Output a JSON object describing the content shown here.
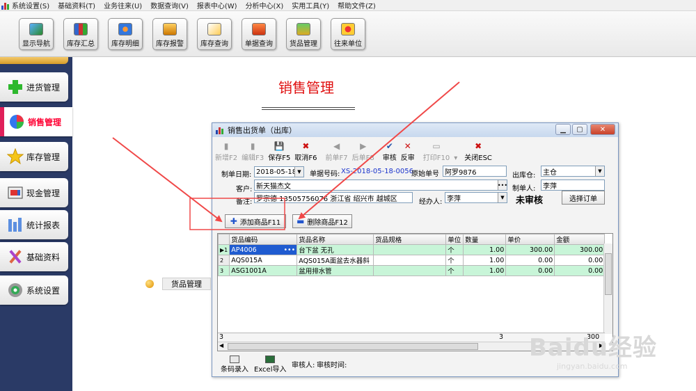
{
  "colors": {
    "accent": "#e01010",
    "sidebar_bg": "#2a3a66",
    "selection": "#1f5bd0",
    "row_green": "#c8f5d8",
    "arrow": "#f04848"
  },
  "menubar": {
    "items": [
      "系统设置(S)",
      "基础资料(T)",
      "业务往来(U)",
      "数据查询(V)",
      "报表中心(W)",
      "分析中心(X)",
      "实用工具(Y)",
      "帮助文件(Z)"
    ]
  },
  "toolbar": {
    "buttons": [
      {
        "label": "显示导航",
        "icon": "navigation-icon"
      },
      {
        "label": "库存汇总",
        "icon": "inventory-summary-icon"
      },
      {
        "label": "库存明细",
        "icon": "inventory-detail-icon"
      },
      {
        "label": "库存报警",
        "icon": "inventory-alarm-icon"
      },
      {
        "label": "库存查询",
        "icon": "inventory-query-icon"
      },
      {
        "label": "单据查询",
        "icon": "document-query-icon"
      },
      {
        "label": "货品管理",
        "icon": "goods-icon"
      },
      {
        "label": "往来单位",
        "icon": "partner-icon"
      }
    ]
  },
  "sidebar": {
    "items": [
      {
        "label": "进货管理",
        "icon": "plus-icon"
      },
      {
        "label": "销售管理",
        "icon": "globe-icon",
        "active": true
      },
      {
        "label": "库存管理",
        "icon": "star-icon"
      },
      {
        "label": "现金管理",
        "icon": "cash-icon"
      },
      {
        "label": "统计报表",
        "icon": "bar-chart-icon"
      },
      {
        "label": "基础资料",
        "icon": "tools-icon"
      },
      {
        "label": "系统设置",
        "icon": "gear-icon"
      }
    ]
  },
  "main": {
    "title": "销售管理",
    "goods_link": "货品管理"
  },
  "dialog": {
    "title": "销售出货单（出库）",
    "toolbar": [
      {
        "label": "新增F2",
        "icon": "▮",
        "disabled": true
      },
      {
        "label": "编辑F3",
        "icon": "▮",
        "disabled": true
      },
      {
        "label": "保存F5",
        "icon": "💾",
        "disabled": false
      },
      {
        "label": "取消F6",
        "icon": "✖",
        "disabled": false
      },
      {
        "label": "前单F7",
        "icon": "◀",
        "disabled": true
      },
      {
        "label": "后单F8",
        "icon": "▶",
        "disabled": true
      },
      {
        "label": "审核",
        "icon": "✔",
        "disabled": false
      },
      {
        "label": "反审",
        "icon": "✕",
        "disabled": false
      },
      {
        "label": "打印F10",
        "icon": "▭",
        "disabled": true
      },
      {
        "label": "▾",
        "icon": "",
        "disabled": true
      },
      {
        "label": "关闭ESC",
        "icon": "✖",
        "disabled": false
      }
    ],
    "form": {
      "date_label": "制单日期:",
      "date_value": "2018-05-18",
      "doc_no_label": "单据号码:",
      "doc_no_value": "XS-2018-05-18-0056",
      "orig_no_label": "原始单号",
      "orig_no_value": "阿罗9876",
      "warehouse_label": "出库仓:",
      "warehouse_value": "主仓",
      "customer_label": "客户:",
      "customer_value": "新天猫杰文",
      "maker_label": "制单人:",
      "maker_value": "李萍",
      "note_label": "备注:",
      "note_value": "罗宗德  13505756076  浙江省  绍兴市  越城区",
      "handler_label": "经办人:",
      "handler_value": "李萍",
      "status": "未审核",
      "select_order": "选择订单"
    },
    "add_goods": "添加商品F11",
    "delete_goods": "删除商品F12",
    "grid": {
      "columns": [
        "货品编码",
        "货品名称",
        "货品规格",
        "单位",
        "数量",
        "单价",
        "金额"
      ],
      "rows": [
        {
          "no": "1",
          "code": "AP4006",
          "name": "台下盆 无孔",
          "spec": "",
          "unit": "个",
          "qty": "1.00",
          "price": "300.00",
          "amount": "300.00"
        },
        {
          "no": "2",
          "code": "AQS015A",
          "name": "AQS015A面盆去水器斜",
          "spec": "",
          "unit": "个",
          "qty": "1.00",
          "price": "0.00",
          "amount": "0.00"
        },
        {
          "no": "3",
          "code": "ASG1001A",
          "name": "盆用排水管",
          "spec": "",
          "unit": "个",
          "qty": "1.00",
          "price": "0.00",
          "amount": "0.00"
        }
      ],
      "footer_count": "3",
      "footer_qty": "3",
      "footer_amount": "300"
    },
    "bottom": {
      "barcode": "条码录入",
      "excel": "Excel导入",
      "auditor": "审核人:",
      "audit_time": "审核时间:"
    }
  },
  "watermark": {
    "text": "Baidu经验",
    "sub": "jingyan.baidu.com"
  }
}
